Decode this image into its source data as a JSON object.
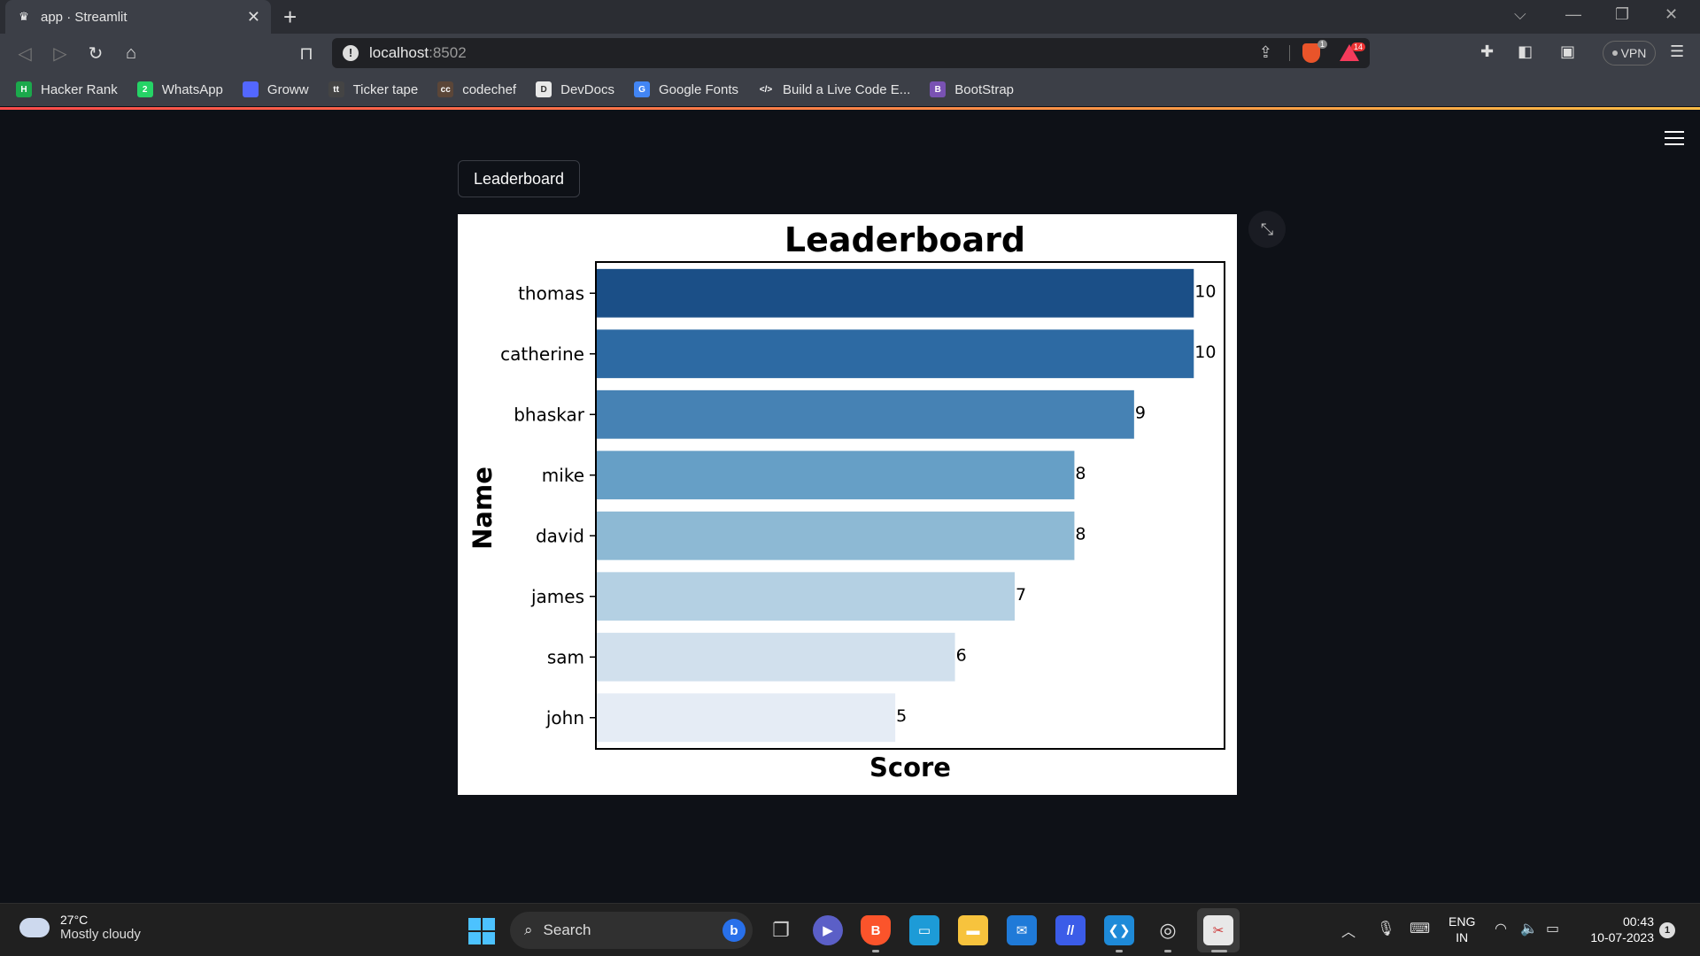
{
  "browser": {
    "tab_title": "app · Streamlit",
    "url_host": "localhost",
    "url_port": ":8502",
    "shields_count": "1",
    "rewards_count": "14",
    "vpn_label": "VPN"
  },
  "bookmarks": [
    {
      "label": "Hacker Rank",
      "icon": "hackerrank-icon",
      "color": "#1ba94c",
      "glyph": "H"
    },
    {
      "label": "WhatsApp",
      "icon": "whatsapp-icon",
      "color": "#25d366",
      "glyph": "2"
    },
    {
      "label": "Groww",
      "icon": "groww-icon",
      "color": "#5367ff",
      "glyph": ""
    },
    {
      "label": "Ticker tape",
      "icon": "tickertape-icon",
      "color": "#444",
      "glyph": "tt"
    },
    {
      "label": "codechef",
      "icon": "codechef-icon",
      "color": "#5b4638",
      "glyph": "cc"
    },
    {
      "label": "DevDocs",
      "icon": "devdocs-icon",
      "color": "#e8e8e8",
      "glyph": "D"
    },
    {
      "label": "Google Fonts",
      "icon": "google-fonts-icon",
      "color": "#4285f4",
      "glyph": "G"
    },
    {
      "label": "Build a Live Code E...",
      "icon": "code-icon",
      "color": "#3c3f47",
      "glyph": "</>"
    },
    {
      "label": "BootStrap",
      "icon": "bootstrap-icon",
      "color": "#7952b3",
      "glyph": "B"
    }
  ],
  "app": {
    "button_label": "Leaderboard"
  },
  "chart_data": {
    "type": "bar",
    "orientation": "horizontal",
    "title": "Leaderboard",
    "xlabel": "Score",
    "ylabel": "Name",
    "categories": [
      "thomas",
      "catherine",
      "bhaskar",
      "mike",
      "david",
      "james",
      "sam",
      "john"
    ],
    "values": [
      10,
      10,
      9,
      8,
      8,
      7,
      6,
      5
    ],
    "data_labels": [
      "10",
      "10",
      "9",
      "8",
      "8",
      "7",
      "6",
      "5"
    ],
    "xlim": [
      0,
      10.5
    ],
    "x_ticks_visible": false,
    "grid": false,
    "colors": [
      "#1b4f87",
      "#2d6aa3",
      "#4682b4",
      "#669fc6",
      "#8db9d4",
      "#b4d0e3",
      "#d1e0ed",
      "#e5ecf5"
    ]
  },
  "taskbar": {
    "temperature": "27°C",
    "weather": "Mostly cloudy",
    "search_label": "Search",
    "lang_top": "ENG",
    "lang_bottom": "IN",
    "time": "00:43",
    "date": "10-07-2023",
    "notifications": "1"
  }
}
